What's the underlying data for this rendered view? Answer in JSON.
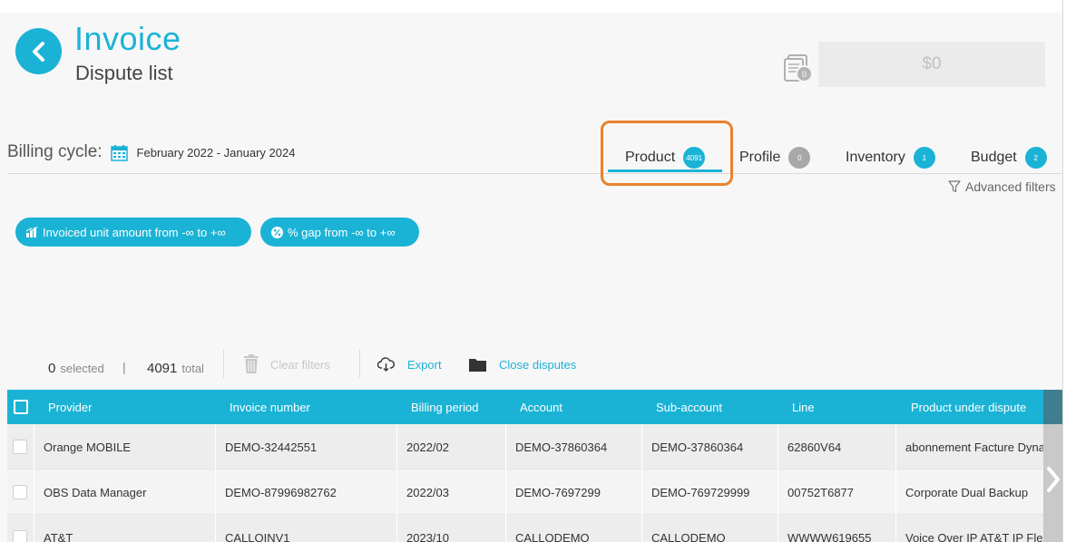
{
  "header": {
    "title": "Invoice",
    "subtitle": "Dispute list",
    "cart_count": "0",
    "amount": "$0"
  },
  "billing": {
    "label": "Billing cycle:",
    "range": "February 2022 - January 2024"
  },
  "tabs": [
    {
      "label": "Product",
      "count": "4091",
      "active": true
    },
    {
      "label": "Profile",
      "count": "0"
    },
    {
      "label": "Inventory",
      "count": "1"
    },
    {
      "label": "Budget",
      "count": "2"
    }
  ],
  "advanced_filters": "Advanced filters",
  "filters": [
    "Invoiced unit amount from -∞ to +∞",
    "% gap from -∞ to +∞"
  ],
  "toolbar": {
    "selected_count": "0",
    "selected_label": "selected",
    "separator": "|",
    "total_count": "4091",
    "total_label": "total",
    "clear_filters": "Clear filters",
    "export": "Export",
    "close_disputes": "Close disputes"
  },
  "table": {
    "columns": [
      "Provider",
      "Invoice number",
      "Billing period",
      "Account",
      "Sub-account",
      "Line",
      "Product under dispute"
    ],
    "rows": [
      [
        "Orange MOBILE",
        "DEMO-32442551",
        "2022/02",
        "DEMO-37860364",
        "DEMO-37860364",
        "62860V64",
        "abonnement Facture Dynamique"
      ],
      [
        "OBS Data Manager",
        "DEMO-87996982762",
        "2022/03",
        "DEMO-7697299",
        "DEMO-769729999",
        "00752T6877",
        "Corporate Dual Backup"
      ],
      [
        "AT&T",
        "CALLOINV1",
        "2023/10",
        "CALLODEMO",
        "CALLODEMO",
        "WWWW619655",
        "Voice Over IP AT&T IP Flexible Reach"
      ]
    ]
  },
  "colors": {
    "accent": "#1ab3d6",
    "highlight": "#e8822e",
    "badge_grey": "#a8a8a8"
  }
}
